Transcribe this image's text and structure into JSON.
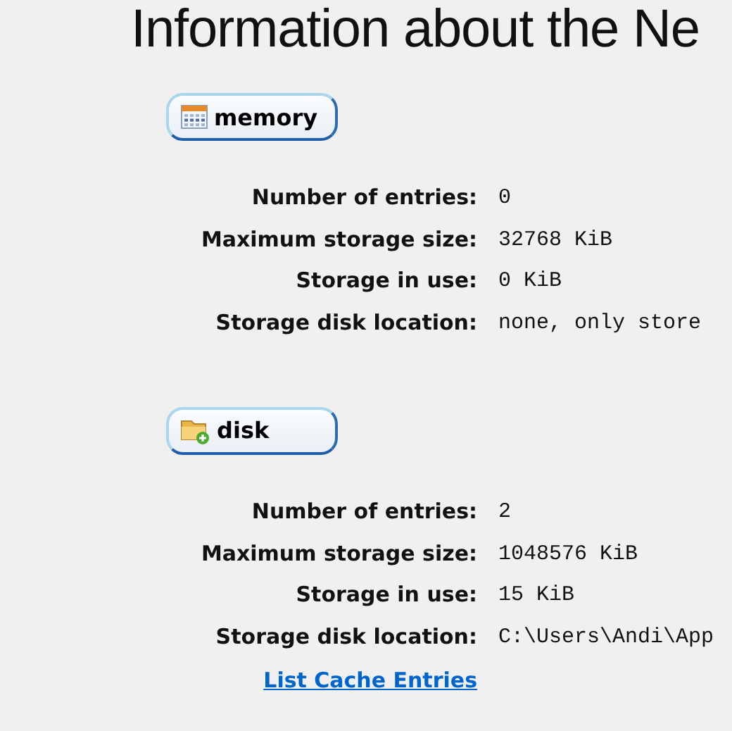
{
  "title": "Information about the Ne",
  "sections": [
    {
      "kind": "memory",
      "heading": "memory",
      "rows": [
        {
          "label": "Number of entries:",
          "value": "0"
        },
        {
          "label": "Maximum storage size:",
          "value": "32768 KiB"
        },
        {
          "label": "Storage in use:",
          "value": "0 KiB"
        },
        {
          "label": "Storage disk location:",
          "value": "none, only store"
        }
      ]
    },
    {
      "kind": "disk",
      "heading": "disk",
      "rows": [
        {
          "label": "Number of entries:",
          "value": "2"
        },
        {
          "label": "Maximum storage size:",
          "value": "1048576 KiB"
        },
        {
          "label": "Storage in use:",
          "value": "15 KiB"
        },
        {
          "label": "Storage disk location:",
          "value": "C:\\Users\\Andi\\App"
        }
      ],
      "link": "List Cache Entries"
    }
  ]
}
